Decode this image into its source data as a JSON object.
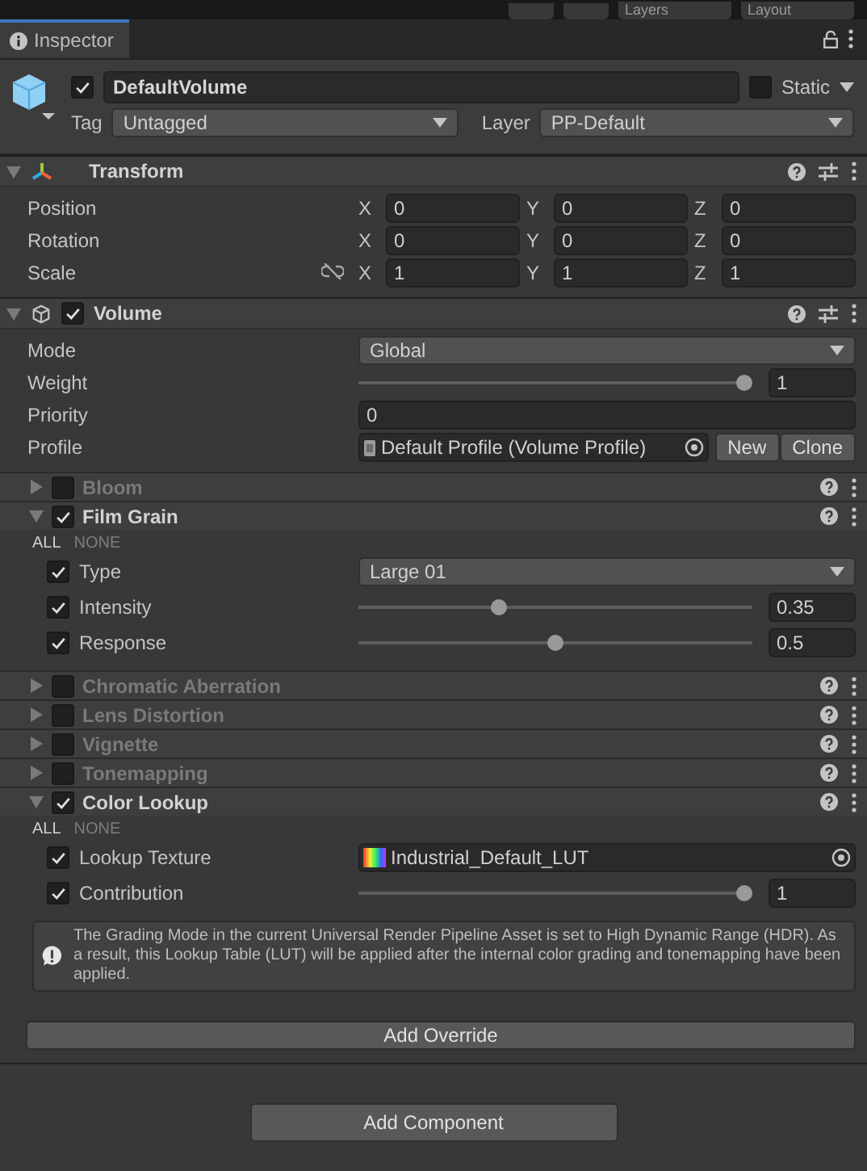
{
  "toolbar": {
    "dropdowns": [
      "Layers",
      "Layout"
    ]
  },
  "tab": {
    "label": "Inspector",
    "selected": true
  },
  "game_object": {
    "active": true,
    "name": "DefaultVolume",
    "static": false,
    "static_label": "Static",
    "tag_label": "Tag",
    "tag": "Untagged",
    "layer_label": "Layer",
    "layer": "PP-Default"
  },
  "transform": {
    "title": "Transform",
    "expanded": true,
    "rows": [
      {
        "label": "Position",
        "fields": [
          {
            "axis": "X",
            "value": "0"
          },
          {
            "axis": "Y",
            "value": "0"
          },
          {
            "axis": "Z",
            "value": "0"
          }
        ]
      },
      {
        "label": "Rotation",
        "fields": [
          {
            "axis": "X",
            "value": "0"
          },
          {
            "axis": "Y",
            "value": "0"
          },
          {
            "axis": "Z",
            "value": "0"
          }
        ]
      },
      {
        "label": "Scale",
        "constrained": false,
        "fields": [
          {
            "axis": "X",
            "value": "1"
          },
          {
            "axis": "Y",
            "value": "1"
          },
          {
            "axis": "Z",
            "value": "1"
          }
        ]
      }
    ]
  },
  "volume": {
    "title": "Volume",
    "enabled": true,
    "expanded": true,
    "rows": [
      {
        "kind": "dropdown",
        "label": "Mode",
        "value": "Global"
      },
      {
        "kind": "slider",
        "label": "Weight",
        "level": 1,
        "value": "1"
      },
      {
        "kind": "field",
        "label": "Priority",
        "value": "0"
      },
      {
        "kind": "object",
        "label": "Profile",
        "value": "Default Profile (Volume Profile)",
        "buttons": [
          "New",
          "Clone"
        ]
      }
    ]
  },
  "overrides": [
    {
      "title": "Bloom",
      "enabled": false,
      "expanded": false
    },
    {
      "title": "Film Grain",
      "enabled": true,
      "expanded": true,
      "all_label": "ALL",
      "none_label": "NONE",
      "rows": [
        {
          "kind": "dropdown",
          "label": "Type",
          "overridden": true,
          "value": "Large 01"
        },
        {
          "kind": "slider",
          "label": "Intensity",
          "overridden": true,
          "level": 0.35,
          "value": "0.35"
        },
        {
          "kind": "slider",
          "label": "Response",
          "overridden": true,
          "level": 0.5,
          "value": "0.5"
        }
      ]
    },
    {
      "title": "Chromatic Aberration",
      "enabled": false,
      "expanded": false
    },
    {
      "title": "Lens Distortion",
      "enabled": false,
      "expanded": false
    },
    {
      "title": "Vignette",
      "enabled": false,
      "expanded": false
    },
    {
      "title": "Tonemapping",
      "enabled": false,
      "expanded": false
    },
    {
      "title": "Color Lookup",
      "enabled": true,
      "expanded": true,
      "all_label": "ALL",
      "none_label": "NONE",
      "rows": [
        {
          "kind": "texture",
          "label": "Lookup Texture",
          "overridden": true,
          "value": "Industrial_Default_LUT"
        },
        {
          "kind": "slider",
          "label": "Contribution",
          "overridden": true,
          "level": 1,
          "value": "1"
        }
      ],
      "warning": "The Grading Mode in the current Universal Render Pipeline Asset is set to High Dynamic Range (HDR). As a result, this Lookup Table (LUT) will be applied after the internal color grading and tonemapping have been applied."
    }
  ],
  "add_override": "Add Override",
  "add_component": "Add Component"
}
